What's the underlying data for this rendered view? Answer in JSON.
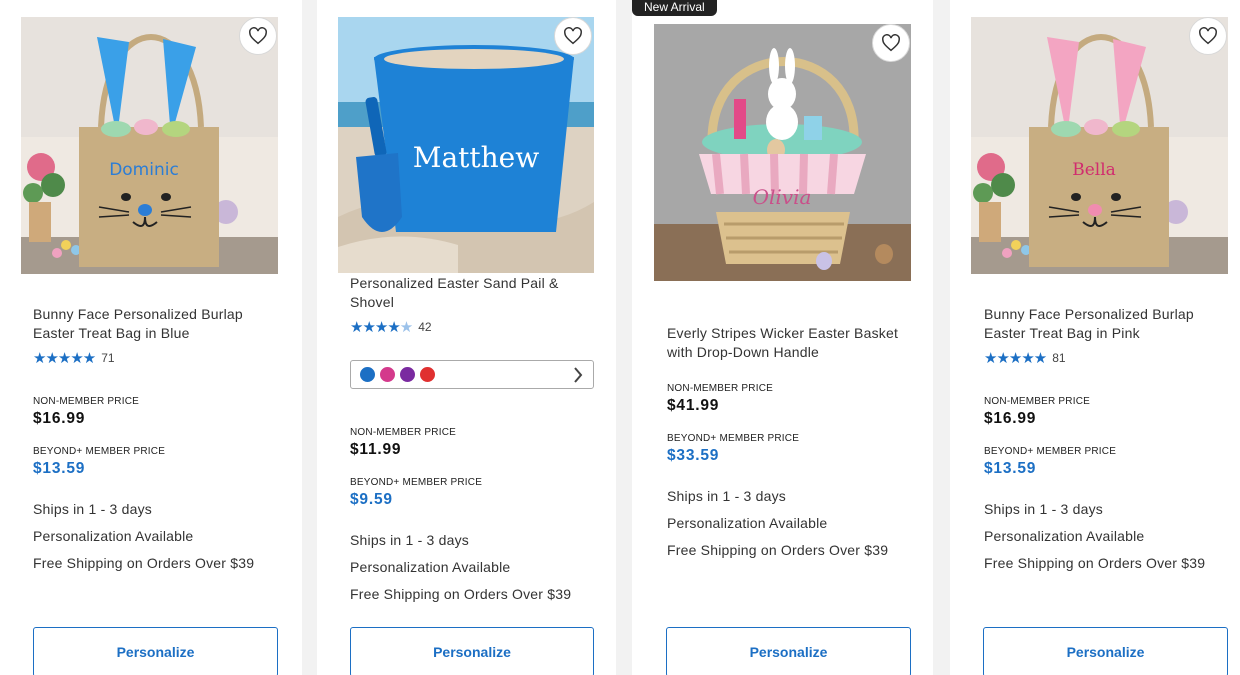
{
  "products": [
    {
      "title": "Bunny Face Personalized Burlap Easter Treat Bag in Blue",
      "image_name": "Dominic",
      "rating_count": "71",
      "non_member_label": "NON-MEMBER PRICE",
      "non_member_price": "$16.99",
      "member_label": "BEYOND+ MEMBER PRICE",
      "member_price": "$13.59",
      "perks": [
        "Ships in 1 - 3 days",
        "Personalization Available",
        "Free Shipping on Orders Over $39"
      ],
      "button": "Personalize",
      "stars": 5
    },
    {
      "title": "Personalized Easter Sand Pail & Shovel",
      "image_name": "Matthew",
      "rating_count": "42",
      "swatches": [
        "#1c6fc4",
        "#d43a8c",
        "#7a2aa0",
        "#e03030"
      ],
      "non_member_label": "NON-MEMBER PRICE",
      "non_member_price": "$11.99",
      "member_label": "BEYOND+ MEMBER PRICE",
      "member_price": "$9.59",
      "perks": [
        "Ships in 1 - 3 days",
        "Personalization Available",
        "Free Shipping on Orders Over $39"
      ],
      "button": "Personalize",
      "stars": 4.5
    },
    {
      "badge": "New Arrival",
      "title": "Everly Stripes Wicker Easter Basket with Drop-Down Handle",
      "image_name": "Olivia",
      "non_member_label": "NON-MEMBER PRICE",
      "non_member_price": "$41.99",
      "member_label": "BEYOND+ MEMBER PRICE",
      "member_price": "$33.59",
      "perks": [
        "Ships in 1 - 3 days",
        "Personalization Available",
        "Free Shipping on Orders Over $39"
      ],
      "button": "Personalize"
    },
    {
      "title": "Bunny Face Personalized Burlap Easter Treat Bag in Pink",
      "image_name": "Bella",
      "rating_count": "81",
      "non_member_label": "NON-MEMBER PRICE",
      "non_member_price": "$16.99",
      "member_label": "BEYOND+ MEMBER PRICE",
      "member_price": "$13.59",
      "perks": [
        "Ships in 1 - 3 days",
        "Personalization Available",
        "Free Shipping on Orders Over $39"
      ],
      "button": "Personalize",
      "stars": 5
    }
  ],
  "icons": {
    "favorite": "heart-icon",
    "swatch_more": "chevron-right-icon",
    "rating": "star-icon"
  },
  "colors": {
    "accent": "#1c6fc4",
    "badge": "#222222"
  }
}
